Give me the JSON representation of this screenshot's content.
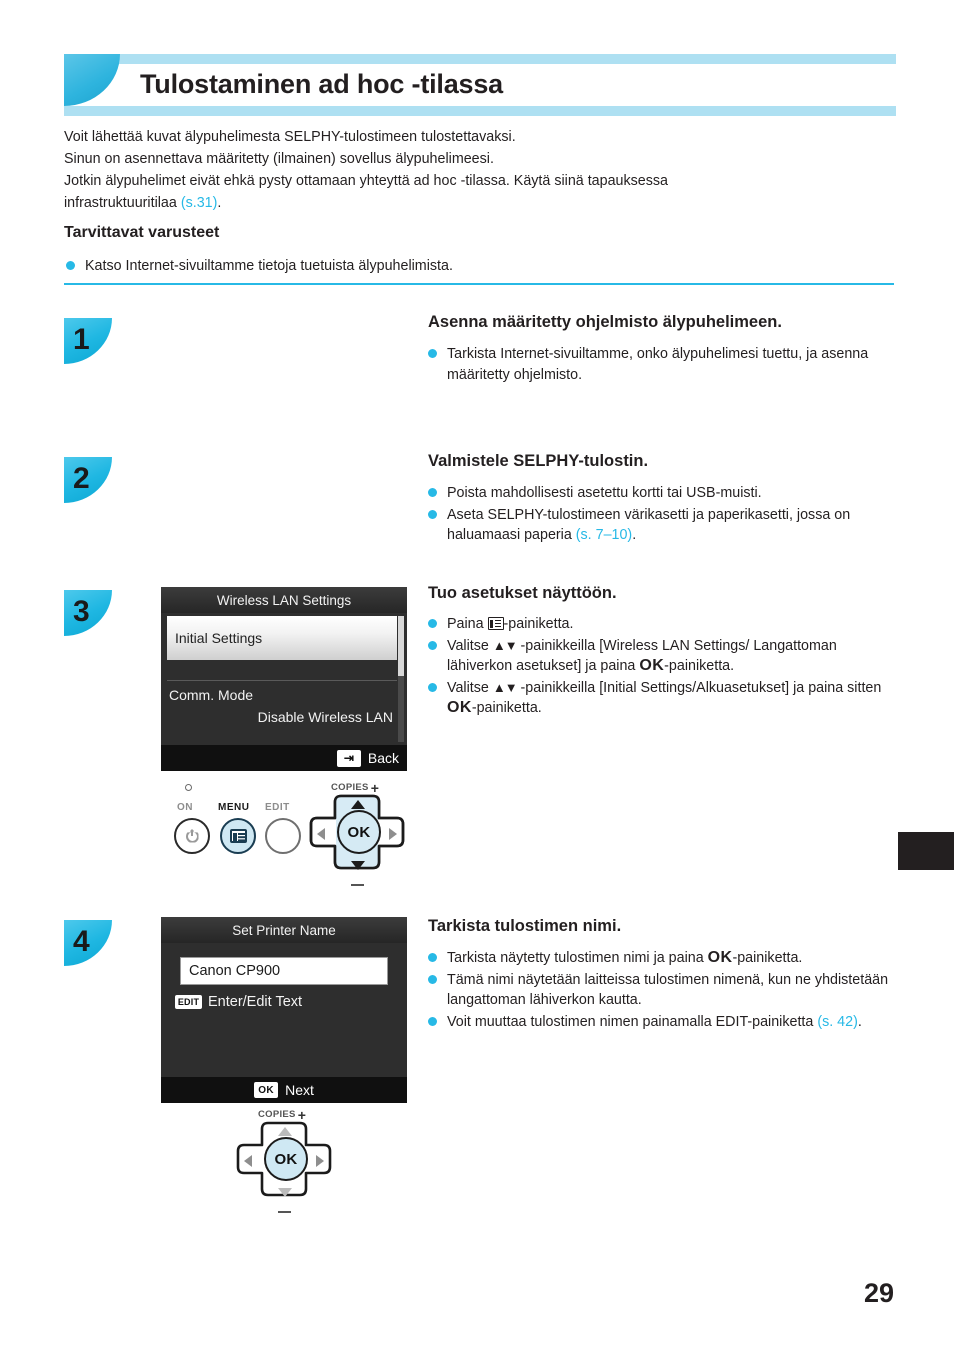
{
  "header": {
    "title": "Tulostaminen ad hoc -tilassa",
    "accent_color": "#27b9e6",
    "banner_bar_color": "#aee0f2"
  },
  "intro": {
    "line1": "Voit lähettää kuvat älypuhelimesta SELPHY-tulostimeen tulostettavaksi.",
    "line2": "Sinun on asennettava määritetty (ilmainen) sovellus älypuhelimeesi.",
    "line3": "Jotkin älypuhelimet eivät ehkä pysty ottamaan yhteyttä ad hoc -tilassa. Käytä siinä tapauksessa",
    "line4_pre": "infrastruktuuritilaa ",
    "line4_ref": "(s.31)",
    "line4_post": "."
  },
  "requirements": {
    "heading": "Tarvittavat varusteet",
    "bullet": "Katso Internet-sivuiltamme tietoja tuetuista älypuhelimista."
  },
  "steps": [
    {
      "number": "1",
      "title": "Asenna määritetty ohjelmisto älypuhelimeen.",
      "bullets": [
        "Tarkista Internet-sivuiltamme, onko älypuhelimesi tuettu, ja asenna määritetty ohjelmisto."
      ]
    },
    {
      "number": "2",
      "title": "Valmistele SELPHY-tulostin.",
      "bullets": [
        "Poista mahdollisesti asetettu kortti tai USB-muisti."
      ],
      "bullet2_pre": "Aseta SELPHY-tulostimeen värikasetti ja paperikasetti, jossa on haluamaasi paperia ",
      "bullet2_ref": "(s. 7–10)",
      "bullet2_post": "."
    },
    {
      "number": "3",
      "title": "Tuo asetukset näyttöön.",
      "b1_pre": "Paina ",
      "b1_post": "-painiketta.",
      "b2_pre": "Valitse ",
      "b2_mid": " -painikkeilla [Wireless LAN Settings/ Langattoman lähiverkon asetukset] ja paina ",
      "b2_ok": "OK",
      "b2_post": "-painiketta.",
      "b3_pre": "Valitse ",
      "b3_mid": " -painikkeilla [Initial Settings/Alkuasetukset] ja paina sitten ",
      "b3_ok": "OK",
      "b3_post": "-painiketta."
    },
    {
      "number": "4",
      "title": "Tarkista tulostimen nimi.",
      "b1_pre": "Tarkista näytetty tulostimen nimi ja paina ",
      "b1_ok": "OK",
      "b1_post": "-painiketta.",
      "b2": "Tämä nimi näytetään laitteissa tulostimen nimenä, kun ne yhdistetään langattoman lähiverkon kautta.",
      "b3_pre": "Voit muuttaa tulostimen nimen painamalla EDIT-painiketta ",
      "b3_ref": "(s. 42)",
      "b3_post": "."
    }
  ],
  "lcd_wireless": {
    "title": "Wireless LAN Settings",
    "selected_item": "Initial Settings",
    "item2_label": "Comm. Mode",
    "item2_value": "Disable Wireless LAN",
    "footer_key": "back-icon",
    "footer_label": "Back"
  },
  "lcd_printer_name": {
    "title": "Set Printer Name",
    "field_value": "Canon CP900",
    "edit_key": "EDIT",
    "edit_label": "Enter/Edit Text",
    "footer_key": "OK",
    "footer_label": "Next"
  },
  "button_panel": {
    "on_label": "ON",
    "menu_label": "MENU",
    "edit_label": "EDIT",
    "copies_label": "COPIES",
    "ok_label": "OK"
  },
  "nav_pad_bottom": {
    "copies_label": "COPIES",
    "ok_label": "OK"
  },
  "page_number": "29"
}
